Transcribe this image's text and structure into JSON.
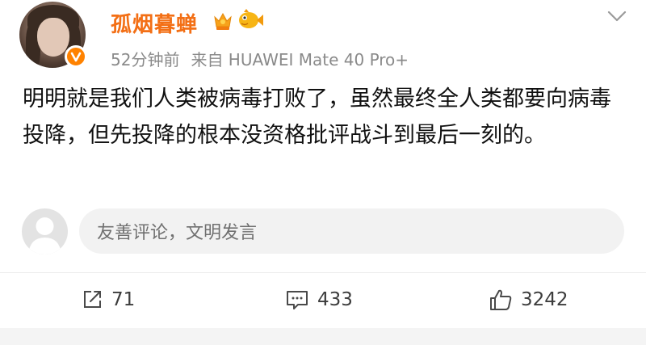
{
  "post": {
    "username": "孤烟暮蝉",
    "time": "52分钟前",
    "source": "来自 HUAWEI Mate 40 Pro+",
    "content": "明明就是我们人类被病毒打败了，虽然最终全人类都要向病毒投降，但先投降的根本没资格批评战斗到最后一刻的。"
  },
  "comment": {
    "placeholder": "友善评论，文明发言"
  },
  "actions": {
    "repost_count": "71",
    "comment_count": "433",
    "like_count": "3242"
  },
  "colors": {
    "username": "#f36f15",
    "verified_badge": "#ff8200",
    "meta_text": "#8a8a8a"
  },
  "icons": [
    "collapse-chevron-icon",
    "verified-icon",
    "crown-badge-icon",
    "fish-badge-icon",
    "repost-icon",
    "comment-icon",
    "like-icon"
  ]
}
